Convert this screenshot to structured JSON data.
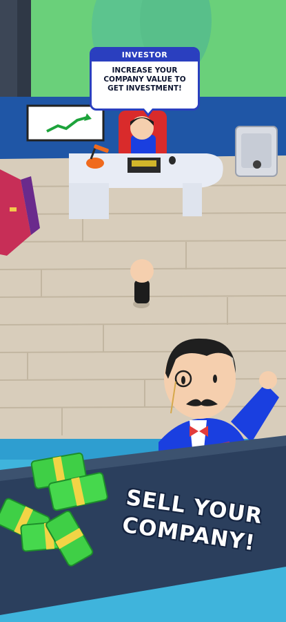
{
  "investor_bubble": {
    "title": "INVESTOR",
    "message_line1": "INCREASE YOUR",
    "message_line2": "COMPANY VALUE TO",
    "message_line3": "GET INVESTMENT!"
  },
  "banner": {
    "line1": "SELL YOUR",
    "line2": "COMPANY!"
  },
  "colors": {
    "floor": "#d8cdbb",
    "wall": "#1f56a6",
    "banner_bg": "#2b3f5d",
    "water": "#3fb4dc",
    "money": "#3fcf46",
    "suit": "#1a3fe0",
    "bubble_accent": "#2a3fbf"
  },
  "icons": [
    "growth-chart-icon",
    "safe-icon",
    "money-stack-icon",
    "monocle-icon"
  ]
}
